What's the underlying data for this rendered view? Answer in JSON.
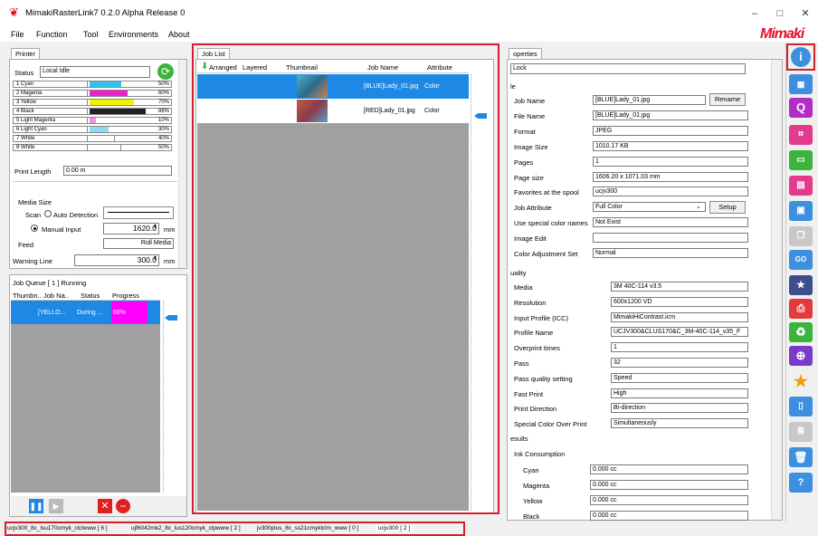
{
  "window": {
    "title": "MimakiRasterLink7 0.2.0 Alpha Release 0",
    "minimize": "–",
    "maximize": "□",
    "close": "✕",
    "logo": "Mimaki"
  },
  "menu": [
    "File",
    "Function",
    "Tool",
    "Environments",
    "About"
  ],
  "printer": {
    "tab": "Printer",
    "status_label": "Status",
    "status_value": "Local Idle",
    "inks": [
      {
        "name": "1 Cyan",
        "pct": "50%",
        "fill": 0.5,
        "color": "#33c2f0"
      },
      {
        "name": "2 Magenta",
        "pct": "60%",
        "fill": 0.6,
        "color": "#f020c8"
      },
      {
        "name": "3 Yellow",
        "pct": "70%",
        "fill": 0.7,
        "color": "#f5f000"
      },
      {
        "name": "4 Black",
        "pct": "88%",
        "fill": 0.88,
        "color": "#222222"
      },
      {
        "name": "5 Light Magenta",
        "pct": "10%",
        "fill": 0.1,
        "color": "#f090e0"
      },
      {
        "name": "6 Light Cyan",
        "pct": "30%",
        "fill": 0.3,
        "color": "#90d8f5"
      },
      {
        "name": "7 White",
        "pct": "40%",
        "fill": 0.4,
        "color": "#ffffff"
      },
      {
        "name": "8 White",
        "pct": "50%",
        "fill": 0.5,
        "color": "#ffffff"
      }
    ],
    "print_length_label": "Print Length",
    "print_length_value": "0.00 m",
    "media_size_label": "Media Size",
    "scan_label": "Scan",
    "auto_detection": "Auto Detection",
    "manual_input": "Manual Input",
    "manual_value": "1620.0",
    "mm": "mm",
    "feed_label": "Feed",
    "feed_value": "Roll Media",
    "warning_line_label": "Warning Line",
    "warning_line_value": "300.0",
    "mm2": "mm"
  },
  "job_queue": {
    "tab": "Job Queue [ 1 ] Running",
    "headers": [
      "Thumbn..",
      "Job Na..",
      "Status",
      "Progress"
    ],
    "row": {
      "name": "[YELLO...",
      "status": "During ...",
      "progress": "68%"
    }
  },
  "job_list": {
    "tab": "Job List",
    "headers": [
      "Arranged",
      "Layered",
      "Thumbnail",
      "Job Name",
      "Attribute"
    ],
    "rows": [
      {
        "name": "[BLUE]Lady_01.jpg",
        "attr": "Color",
        "selected": true
      },
      {
        "name": "[RED]Lady_01.jpg",
        "attr": "Color",
        "selected": false
      }
    ]
  },
  "properties": {
    "tab": "operties",
    "lock": "Lock",
    "section_file": "le",
    "rows_file": [
      {
        "label": "Job Name",
        "value": "[BLUE]Lady_01.jpg"
      },
      {
        "label": "File Name",
        "value": "[BLUE]Lady_01.jpg"
      },
      {
        "label": "Format",
        "value": "JPEG"
      },
      {
        "label": "Image Size",
        "value": "1010.17 KB"
      },
      {
        "label": "Pages",
        "value": "1"
      },
      {
        "label": "Page size",
        "value": "1606.20 x 1071.03 mm"
      },
      {
        "label": "Favorites at the spool",
        "value": "ucjv300"
      },
      {
        "label": "Job Attribute",
        "value": "Full Color"
      },
      {
        "label": "Use special color names",
        "value": "Not Exist"
      },
      {
        "label": "Image Edit",
        "value": ""
      },
      {
        "label": "Color Adjustment Set",
        "value": "Normal"
      }
    ],
    "rename": "Rename",
    "setup": "Setup",
    "section_quality": "uality",
    "rows_quality": [
      {
        "label": "Media",
        "value": "3M 40C-114 v3.5"
      },
      {
        "label": "Resolution",
        "value": "600x1200 VD"
      },
      {
        "label": "Input Profile (ICC)",
        "value": "MimakiHiContrast.icm"
      },
      {
        "label": "Profile Name",
        "value": "UCJV300&CLUS170&C_3M-40C-114_v35_F"
      },
      {
        "label": "Overprint times",
        "value": "1"
      },
      {
        "label": "Pass",
        "value": "32"
      },
      {
        "label": "Pass quality setting",
        "value": "Speed"
      },
      {
        "label": "Fast Print",
        "value": "High"
      },
      {
        "label": "Print Direction",
        "value": "Bi-direction"
      },
      {
        "label": "Special Color Over Print",
        "value": "Simultaneously"
      }
    ],
    "section_results": "esults",
    "ink_consumption": "Ink Consumption",
    "rows_ink": [
      {
        "label": "Cyan",
        "value": "0.000 cc"
      },
      {
        "label": "Magenta",
        "value": "0.000 cc"
      },
      {
        "label": "Yellow",
        "value": "0.000 cc"
      },
      {
        "label": "Black",
        "value": "0.000 cc"
      }
    ]
  },
  "bottom_tabs": [
    "ucjv300_8c_lsu170cmyk_clclwww [ 6 ]",
    "ujf6042mk2_8c_lus120cmyk_clpwww [ 2 ]",
    "jv300plus_8c_ss21cmyklclm_www [ 0 ]",
    "ucjv300 [ 2 ]"
  ]
}
